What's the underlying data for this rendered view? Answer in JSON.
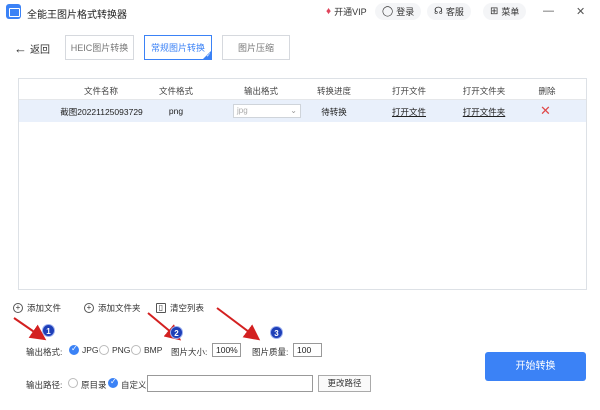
{
  "titlebar": {
    "title": "全能王图片格式转换器",
    "vip": "开通VIP",
    "login": "登录",
    "service": "客服",
    "menu": "菜单",
    "minimize": "—",
    "close": "✕"
  },
  "nav": {
    "back": "返回",
    "tabs": [
      "HEIC图片转换",
      "常规图片转换",
      "图片压缩"
    ],
    "active_tab": "常规图片转换"
  },
  "table": {
    "headers": [
      "文件名称",
      "文件格式",
      "输出格式",
      "转换进度",
      "打开文件",
      "打开文件夹",
      "删除"
    ],
    "rows": [
      {
        "name": "截图20221125093729",
        "format": "png",
        "output": "jpg",
        "progress": "待转换",
        "open_file": "打开文件",
        "open_folder": "打开文件夹"
      }
    ]
  },
  "actions": {
    "add_file": "添加文件",
    "add_folder": "添加文件夹",
    "clear_list": "清空列表"
  },
  "options": {
    "format_label": "输出格式:",
    "formats": [
      "JPG",
      "PNG",
      "BMP"
    ],
    "selected_format": "JPG",
    "size_label": "图片大小:",
    "size_value": "100%",
    "quality_label": "图片质量:",
    "quality_value": "100",
    "path_label": "输出路径:",
    "path_options": [
      "原目录",
      "自定义"
    ],
    "selected_path": "自定义",
    "path_value": "",
    "change_path": "更改路径"
  },
  "start_button": "开始转换",
  "annotations": [
    "1",
    "2",
    "3"
  ],
  "colors": {
    "accent": "#3b82f6",
    "badge": "#1e3fb8",
    "arrow": "#d32020",
    "delete": "#e04848",
    "row_highlight": "#e9f0fb"
  }
}
